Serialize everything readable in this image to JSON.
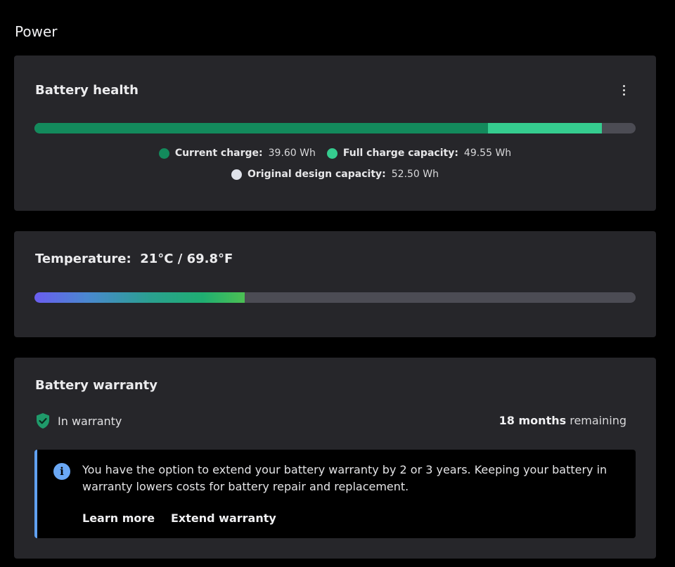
{
  "page": {
    "title": "Power"
  },
  "battery_health": {
    "title": "Battery health",
    "more_icon": "more-vertical-icon",
    "current_charge_wh": 39.6,
    "full_charge_capacity_wh": 49.55,
    "original_design_capacity_wh": 52.5,
    "legend": {
      "current_label": "Current charge:",
      "current_value": "39.60 Wh",
      "full_label": "Full charge capacity:",
      "full_value": "49.55 Wh",
      "design_label": "Original design capacity:",
      "design_value": "52.50 Wh"
    },
    "colors": {
      "current": "#138a5c",
      "full": "#35cc8f",
      "design": "#dfe2ea",
      "track": "#4c4c54"
    }
  },
  "temperature": {
    "label": "Temperature:",
    "value": "21°C / 69.8°F",
    "level_fraction": 0.35
  },
  "battery_warranty": {
    "title": "Battery warranty",
    "status_icon": "shield-check-icon",
    "status": "In warranty",
    "remaining_strong": "18 months",
    "remaining_rest": " remaining",
    "info": {
      "icon": "info-icon",
      "text": "You have the option to extend your battery warranty by 2 or 3 years. Keeping your battery in warranty lowers costs for battery repair and replacement.",
      "learn_more": "Learn more",
      "extend": "Extend warranty"
    },
    "colors": {
      "shield": "#1f9a6a",
      "info_accent": "#60a0f0"
    }
  }
}
